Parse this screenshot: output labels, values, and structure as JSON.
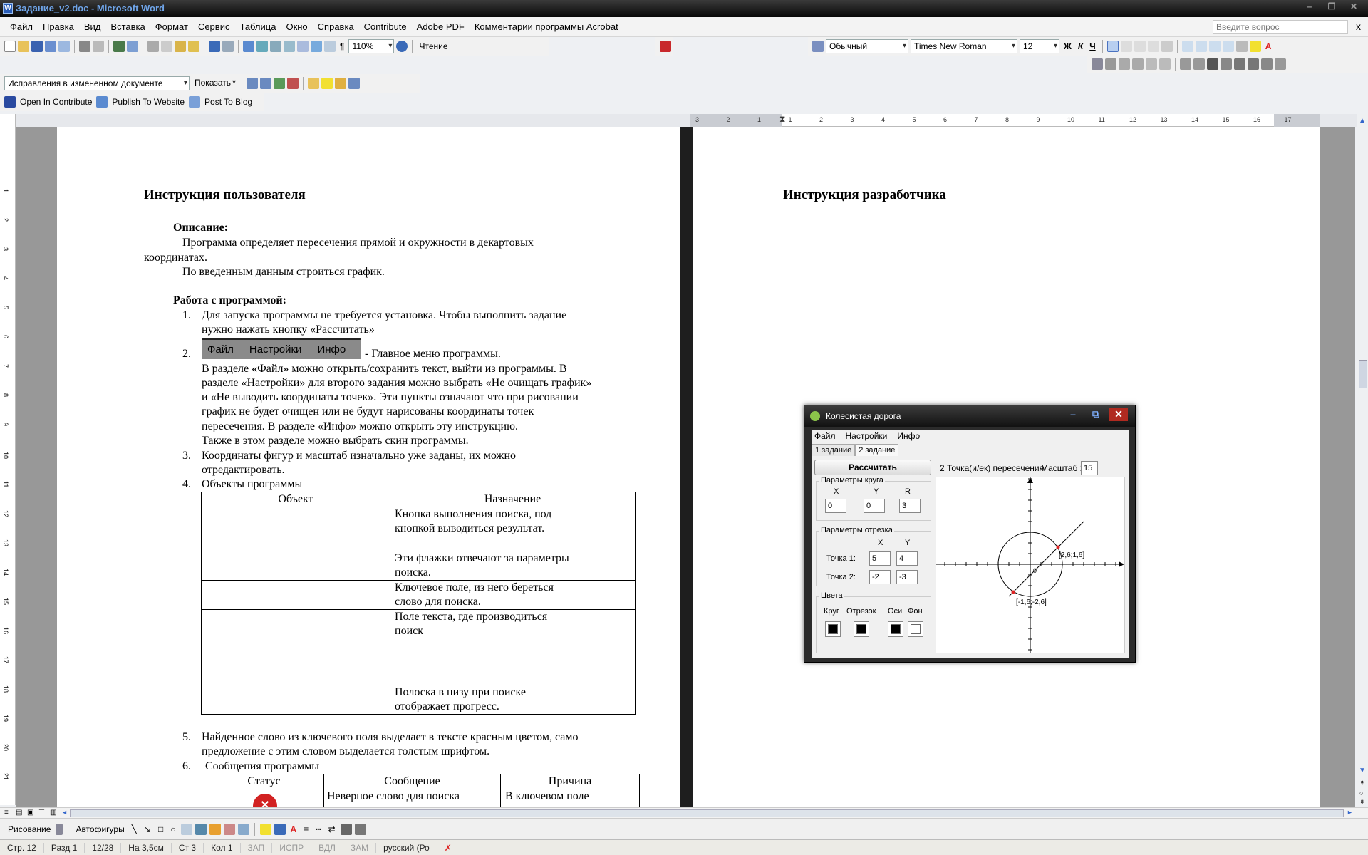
{
  "window": {
    "title": "Задание_v2.doc - Microsoft Word",
    "icon": "word-doc-icon"
  },
  "menubar": {
    "items": [
      "Файл",
      "Правка",
      "Вид",
      "Вставка",
      "Формат",
      "Сервис",
      "Таблица",
      "Окно",
      "Справка",
      "Contribute",
      "Adobe PDF",
      "Комментарии программы Acrobat"
    ],
    "ask_placeholder": "Введите вопрос",
    "close_doc": "x"
  },
  "toolbar_standard": {
    "zoom": "110%",
    "reading": "Чтение"
  },
  "toolbar_format": {
    "style": "Обычный",
    "font": "Times New Roman",
    "size": "12",
    "bold": "Ж",
    "italic": "К",
    "underline": "Ч",
    "font_color_letter": "A"
  },
  "toolbar_review": {
    "mode": "Исправления в измененном документе",
    "show": "Показать"
  },
  "toolbar_contribute": {
    "open": "Open In Contribute",
    "publish": "Publish To Website",
    "post": "Post To Blog"
  },
  "ruler": {
    "corner": "L",
    "ticks": [
      "3",
      "2",
      "1",
      "1",
      "2",
      "3",
      "4",
      "5",
      "6",
      "7",
      "8",
      "9",
      "10",
      "11",
      "12",
      "13",
      "14",
      "15",
      "16",
      "17"
    ]
  },
  "vruler_ticks": [
    "1",
    "2",
    "3",
    "4",
    "5",
    "6",
    "7",
    "8",
    "9",
    "10",
    "11",
    "12",
    "13",
    "14",
    "15",
    "16",
    "17",
    "18",
    "19",
    "20",
    "21"
  ],
  "left_page": {
    "heading": "Инструкция пользователя",
    "desc_title": "Описание:",
    "desc_1a": "Программа определяет пересечения прямой и окружности в декартовых",
    "desc_1b": "координатах.",
    "desc_2": "По введенным данным строиться график.",
    "work_title": "Работа с программой:",
    "item1_num": "1.",
    "item1a": "Для запуска программы не требуется установка. Чтобы выполнить задание",
    "item1b": "нужно нажать кнопку «Рассчитать»",
    "item2_num": "2.",
    "menu_img": [
      "Файл",
      "Настройки",
      "Инфо"
    ],
    "item2_tail": "- Главное меню программы.",
    "item2_p1": "В разделе «Файл» можно открыть/сохранить текст, выйти из программы. В",
    "item2_p2": "разделе «Настройки» для второго задания можно выбрать «Не очищать график»",
    "item2_p3": "и «Не выводить координаты точек». Эти пункты означают что при рисовании",
    "item2_p4": "график не будет очищен или не будут нарисованы координаты точек",
    "item2_p5": "пересечения. В разделе «Инфо» можно открыть эту инструкцию.",
    "item2_p6": "Также в этом разделе можно выбрать скин программы.",
    "item3_num": "3.",
    "item3a": "Координаты фигур и масштаб изначально уже заданы, их можно",
    "item3b": "отредактировать.",
    "item4_num": "4.",
    "item4": "Объекты программы",
    "table1_headers": [
      "Объект",
      "Назначение"
    ],
    "table1_rows": [
      [
        "",
        "Кнопка выполнения поиска, под кнопкой выводиться результат."
      ],
      [
        "",
        "Эти флажки отвечают за параметры поиска."
      ],
      [
        "",
        "Ключевое поле, из него береться слово для поиска."
      ],
      [
        "",
        "Поле текста, где производиться поиск"
      ],
      [
        "",
        "Полоска в низу при поиске отображает прогресс."
      ]
    ],
    "item5_num": "5.",
    "item5a": "Найденное слово из ключевого поля выделает  в тексте красным цветом, само",
    "item5b": "предложение с этим словом выделается толстым шрифтом.",
    "item6_num": "6.",
    "item6": "Сообщения программы",
    "table2_headers": [
      "Статус",
      "Сообщение",
      "Причина"
    ],
    "table2_row": [
      "",
      "Неверное слово для поиска",
      "В ключевом поле"
    ]
  },
  "right_page": {
    "heading": "Инструкция разработчика"
  },
  "app": {
    "title": "Колесистая дорога",
    "menu": [
      "Файл",
      "Настройки",
      "Инфо"
    ],
    "tabs": [
      "1 задание",
      "2 задание"
    ],
    "calc_button": "Рассчитать",
    "result": "2 Точка(и/ек) пересечения",
    "scale_label": "Масштаб 1:",
    "scale_value": "15",
    "circle_group": "Параметры круга",
    "circle_labels": [
      "X",
      "Y",
      "R"
    ],
    "circle_values": [
      "0",
      "0",
      "3"
    ],
    "segment_group": "Параметры отрезка",
    "segment_labels": [
      "X",
      "Y"
    ],
    "point1_label": "Точка 1:",
    "point1": [
      "5",
      "4"
    ],
    "point2_label": "Точка 2:",
    "point2": [
      "-2",
      "-3"
    ],
    "colors_group": "Цвета",
    "color_labels": [
      "Круг",
      "Отрезок",
      "Оси",
      "Фон"
    ],
    "graph_labels": {
      "p1": "[2,6;1,6]",
      "p2": "[-1,6;-2,6]",
      "origin": "0"
    }
  },
  "drawing_toolbar": {
    "draw": "Рисование",
    "autoshapes": "Автофигуры"
  },
  "status": {
    "page": "Стр. 12",
    "section": "Разд 1",
    "pages": "12/28",
    "at": "На 3,5см",
    "line": "Ст 3",
    "col": "Кол 1",
    "rec": "ЗАП",
    "trk": "ИСПР",
    "ext": "ВДЛ",
    "ovr": "ЗАМ",
    "lang": "русский (Ро"
  },
  "colors": {
    "accent": "#2a5db8",
    "title_text": "#6fa4e8",
    "error_red": "#d22222"
  }
}
